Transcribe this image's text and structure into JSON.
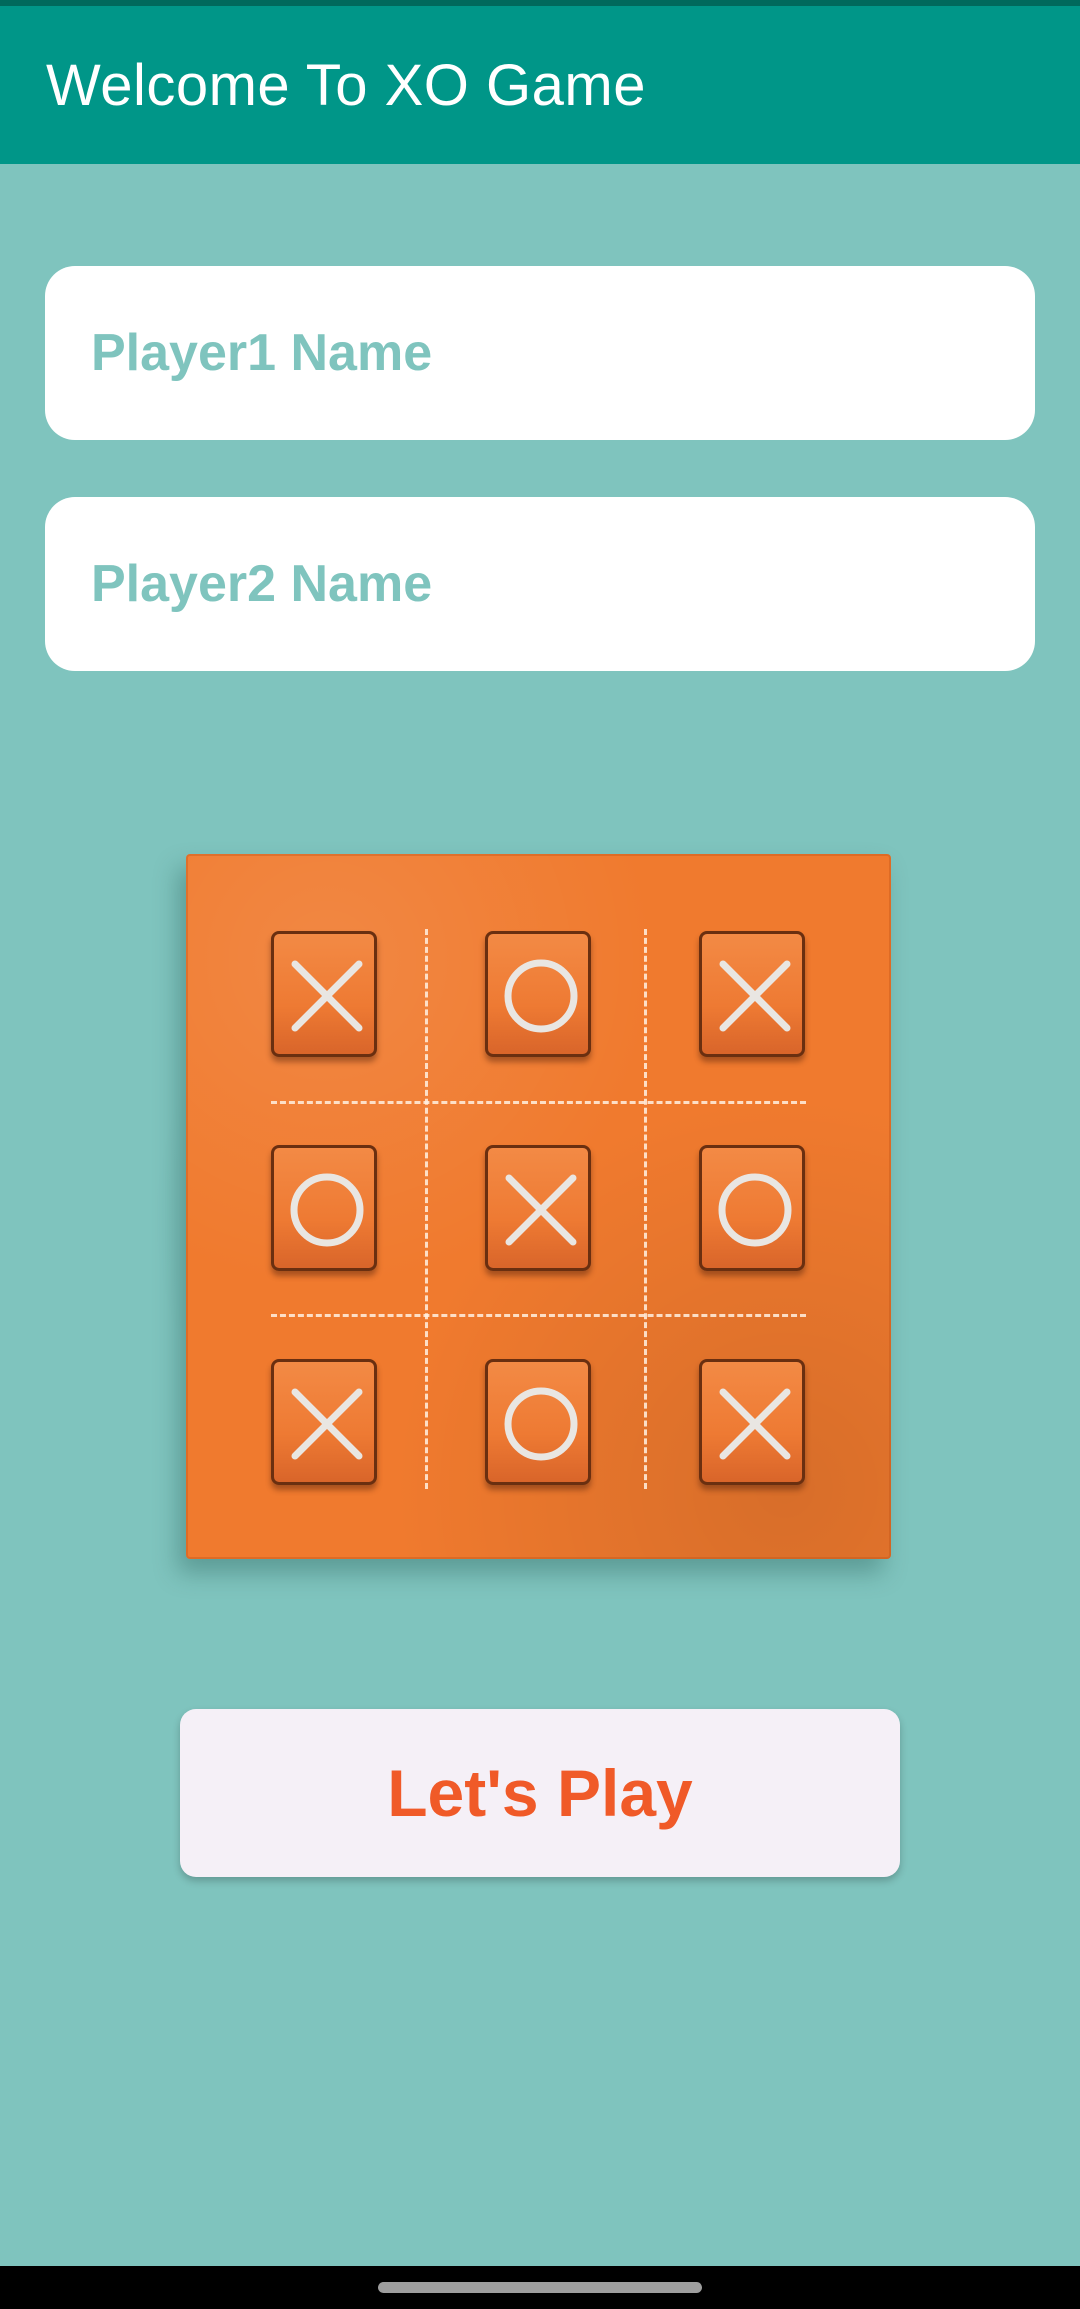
{
  "app_bar": {
    "title": "Welcome To XO Game",
    "color": "#009688"
  },
  "form": {
    "player1": {
      "placeholder": "Player1 Name",
      "value": ""
    },
    "player2": {
      "placeholder": "Player2 Name",
      "value": ""
    }
  },
  "board_image": {
    "description_icon": "tic-tac-toe-board",
    "cells": [
      [
        "X",
        "O",
        "X"
      ],
      [
        "O",
        "X",
        "O"
      ],
      [
        "X",
        "O",
        "X"
      ]
    ],
    "board_color": "#f07a2e"
  },
  "actions": {
    "play_label": "Let's Play"
  },
  "colors": {
    "background": "#7fc4be",
    "accent_text": "#f05a28",
    "app_bar": "#009688"
  }
}
